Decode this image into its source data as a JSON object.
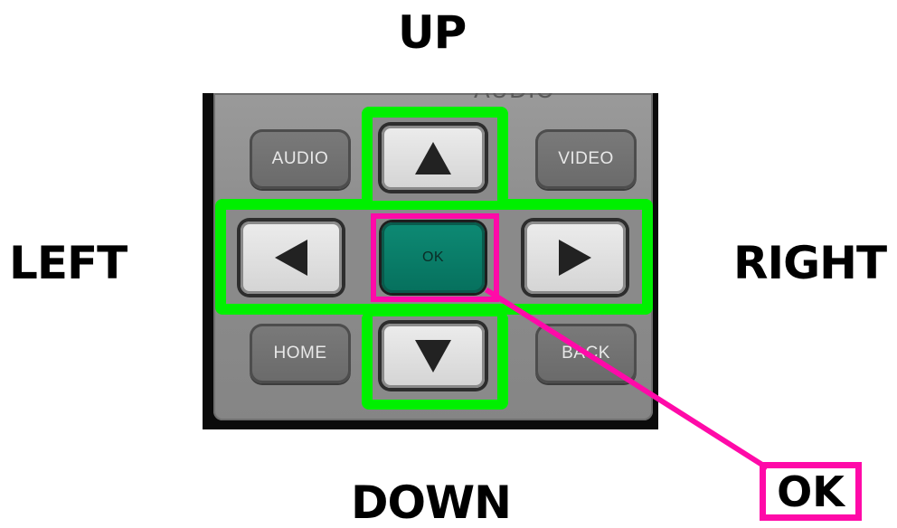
{
  "labels": {
    "up": "UP",
    "left": "LEFT",
    "right": "RIGHT",
    "down": "DOWN",
    "ok_callout": "OK"
  },
  "remote": {
    "ghost_text": "AUDIO",
    "buttons": {
      "audio": "AUDIO",
      "video": "VIDEO",
      "home": "HOME",
      "back": "BACK",
      "ok": "OK"
    },
    "arrow_icons": {
      "up": "triangle-up-icon",
      "down": "triangle-down-icon",
      "left": "triangle-left-icon",
      "right": "triangle-right-icon"
    }
  },
  "colors": {
    "highlight_green": "#00f000",
    "callout_magenta": "#ff0aa8",
    "ok_button_teal": "#0d8a74",
    "label_text": "#000000"
  }
}
